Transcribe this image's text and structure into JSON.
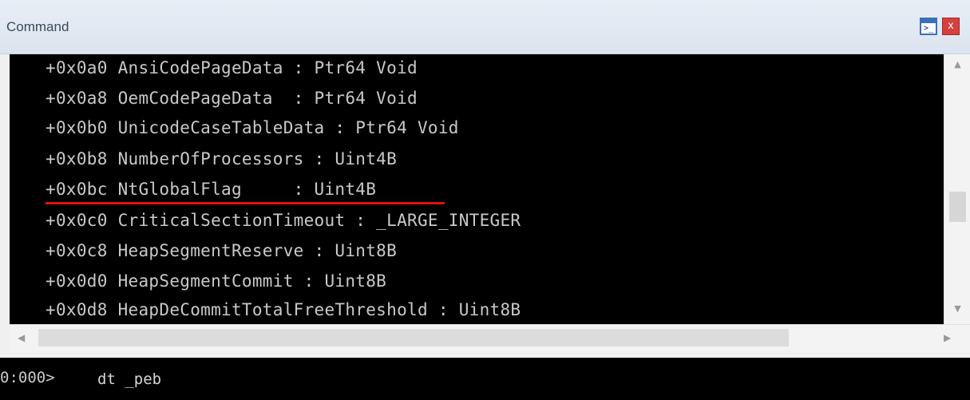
{
  "window": {
    "title": "Command",
    "console_glyph": ">_",
    "close_glyph": "x"
  },
  "output": {
    "lines": [
      "+0x0a0 AnsiCodePageData : Ptr64 Void",
      "+0x0a8 OemCodePageData  : Ptr64 Void",
      "+0x0b0 UnicodeCaseTableData : Ptr64 Void",
      "+0x0b8 NumberOfProcessors : Uint4B",
      "+0x0bc NtGlobalFlag     : Uint4B",
      "+0x0c0 CriticalSectionTimeout : _LARGE_INTEGER",
      "+0x0c8 HeapSegmentReserve : Uint8B",
      "+0x0d0 HeapSegmentCommit : Uint8B",
      "+0x0d8 HeapDeCommitTotalFreeThreshold : Uint8B"
    ],
    "highlighted_line_index": 4,
    "highlight_color": "#e01010"
  },
  "scrollbars": {
    "up_arrow": "▲",
    "down_arrow": "▼",
    "left_arrow": "◀",
    "right_arrow": "▶"
  },
  "command": {
    "prompt": "0:000>",
    "value": "dt _peb"
  },
  "colors": {
    "console_bg": "#000000",
    "console_text": "#c9c9c9",
    "close_button": "#d7403d"
  }
}
